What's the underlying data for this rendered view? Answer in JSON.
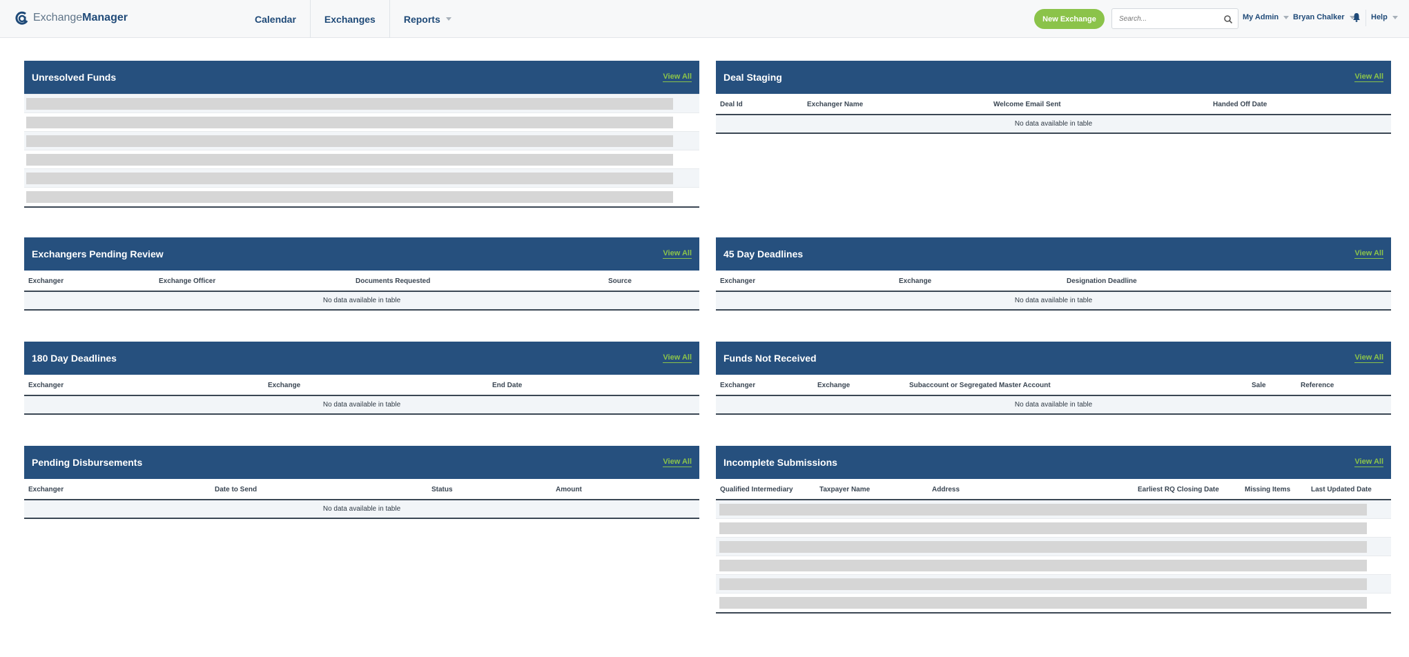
{
  "header": {
    "logo_regular": "Exchange",
    "logo_bold": "Manager",
    "nav": [
      "Calendar",
      "Exchanges",
      "Reports"
    ],
    "new_exchange_label": "New Exchange",
    "search_placeholder": "Search...",
    "my_admin": "My Admin",
    "user_name": "Bryan Chalker",
    "help": "Help"
  },
  "view_all_label": "View All",
  "no_data_text": "No data available in table",
  "panels": {
    "unresolved_funds": {
      "title": "Unresolved Funds"
    },
    "deal_staging": {
      "title": "Deal Staging",
      "columns": [
        "Deal Id",
        "Exchanger Name",
        "Welcome Email Sent",
        "Handed Off Date"
      ]
    },
    "exchangers_pending_review": {
      "title": "Exchangers Pending Review",
      "columns": [
        "Exchanger",
        "Exchange Officer",
        "Documents Requested",
        "Source"
      ]
    },
    "day45_deadlines": {
      "title": "45 Day Deadlines",
      "columns": [
        "Exchanger",
        "Exchange",
        "Designation Deadline"
      ]
    },
    "day180_deadlines": {
      "title": "180 Day Deadlines",
      "columns": [
        "Exchanger",
        "Exchange",
        "End Date"
      ]
    },
    "funds_not_received": {
      "title": "Funds Not Received",
      "columns": [
        "Exchanger",
        "Exchange",
        "Subaccount or Segregated Master Account",
        "Sale",
        "Reference"
      ]
    },
    "pending_disbursements": {
      "title": "Pending Disbursements",
      "columns": [
        "Exchanger",
        "Date to Send",
        "Status",
        "Amount"
      ]
    },
    "incomplete_submissions": {
      "title": "Incomplete Submissions",
      "columns": [
        "Qualified Intermediary",
        "Taxpayer Name",
        "Address",
        "Earliest RQ Closing Date",
        "Missing Items",
        "Last Updated Date"
      ]
    }
  },
  "colors": {
    "header_blue": "#26507e",
    "accent_green": "#8bc34a",
    "nav_blue": "#1f4a78"
  },
  "icons": {
    "logo": "exchange-manager-logo-icon",
    "search": "search-icon",
    "notifications": "bell-icon"
  }
}
